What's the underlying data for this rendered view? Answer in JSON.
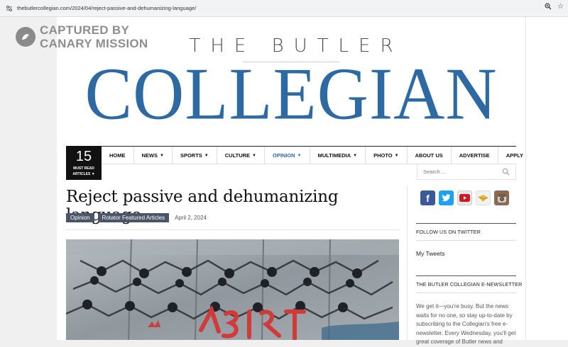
{
  "browser": {
    "url": "thebutlercollegian.com/2024/04/reject-passive-and-dehumanizing-language/"
  },
  "watermark": {
    "line1": "CAPTURED BY",
    "line2": "CANARY MISSION"
  },
  "masthead": {
    "the_butler": "THE BUTLER",
    "collegian": "COLLEGIAN",
    "brand_color": "#2d6aa4"
  },
  "must_read": {
    "count": "15",
    "line1": "MUST READ",
    "line2": "ARTICLES"
  },
  "nav": {
    "items": [
      {
        "label": "HOME"
      },
      {
        "label": "NEWS"
      },
      {
        "label": "SPORTS"
      },
      {
        "label": "CULTURE"
      },
      {
        "label": "OPINION"
      },
      {
        "label": "MULTIMEDIA"
      },
      {
        "label": "PHOTO"
      },
      {
        "label": "ABOUT US"
      },
      {
        "label": "ADVERTISE"
      },
      {
        "label": "APPLY"
      }
    ],
    "search_placeholder": "Search ..."
  },
  "article": {
    "title": "Reject passive and dehumanizing language",
    "tags": [
      "Opinion",
      "Rotator Featured Articles"
    ],
    "date": "April 2, 2024"
  },
  "sidebar": {
    "social": [
      "facebook-icon",
      "twitter-icon",
      "youtube-icon",
      "email-icon",
      "instagram-icon"
    ],
    "follow_heading": "FOLLOW US ON TWITTER",
    "my_tweets": "My Tweets",
    "newsletter_heading": "THE BUTLER COLLEGIAN E-NEWSLETTER",
    "newsletter_text": "We get it—you're busy. But the news waits for no one, so stay up-to-date by subscribing to the Collegian's free e-newsletter. Every Wednesday, you'll get great coverage of Butler news and"
  }
}
